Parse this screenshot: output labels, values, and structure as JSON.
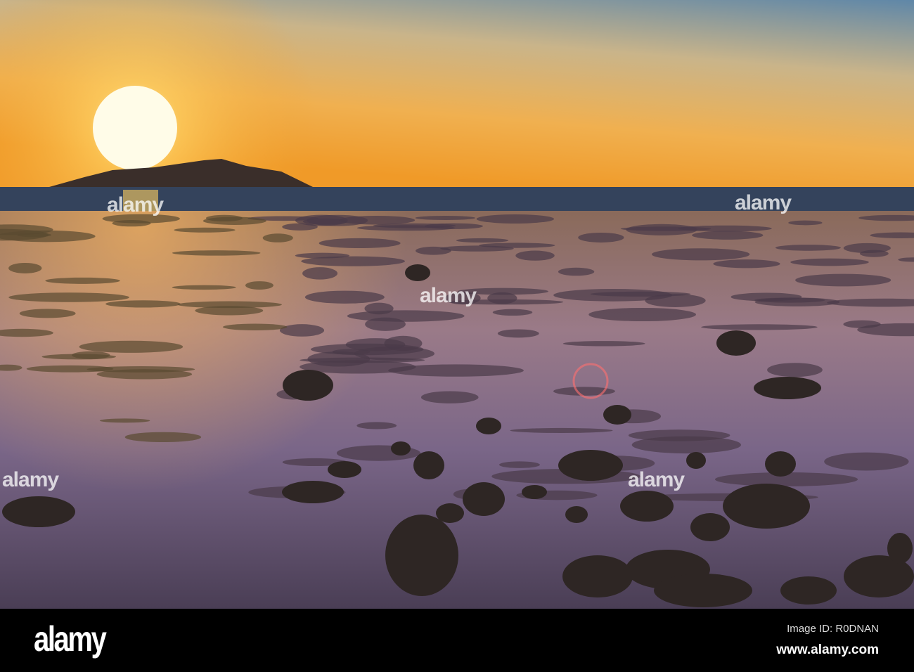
{
  "scene": "sunset over tidal flats with rocks",
  "colors": {
    "sky_top": "#6d8ca6",
    "sky_horizon": "#f2a233",
    "sun": "#fffbe0",
    "sea": "#2e3d55",
    "flat": "#6b5a78"
  },
  "watermark": {
    "text": "alamy"
  },
  "footer": {
    "logo": "alamy",
    "image_id": "Image ID: R0DNAN",
    "url": "www.alamy.com"
  }
}
